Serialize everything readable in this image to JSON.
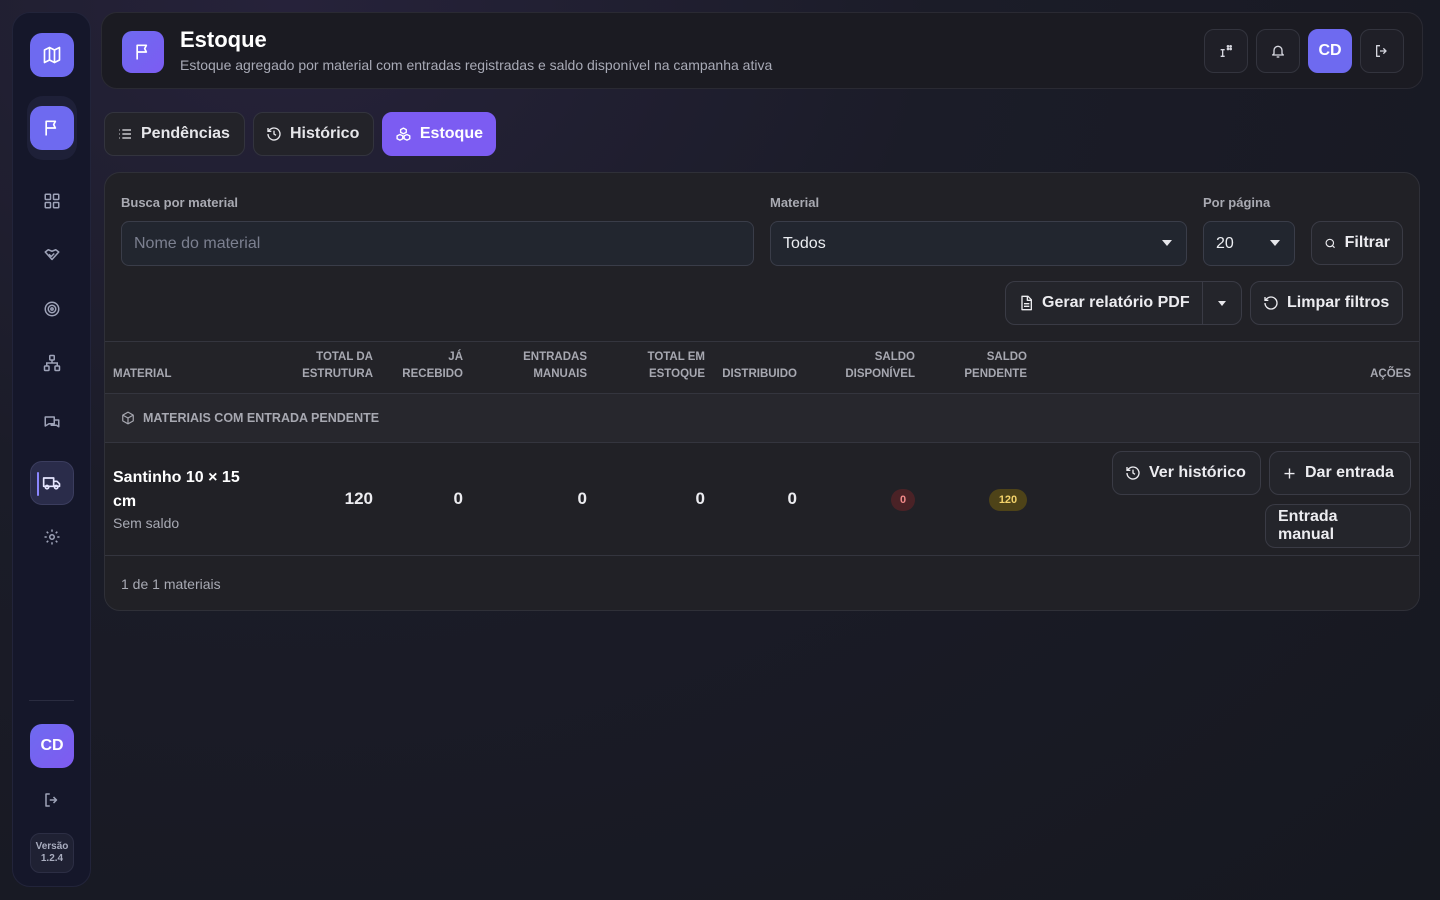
{
  "sidebar": {
    "avatar": "CD",
    "version_label": "Versão",
    "version": "1.2.4",
    "icons": [
      "map-icon",
      "flag-icon",
      "grid-icon",
      "handshake-icon",
      "target-icon",
      "org-chart-icon",
      "chat-icon",
      "truck-icon",
      "gear-icon",
      "logout-icon"
    ]
  },
  "header": {
    "title": "Estoque",
    "subtitle": "Estoque agregado por material com entradas registradas e saldo disponível na campanha ativa",
    "avatar": "CD"
  },
  "tabs": [
    {
      "label": "Pendências",
      "icon": "list-icon"
    },
    {
      "label": "Histórico",
      "icon": "history-icon"
    },
    {
      "label": "Estoque",
      "icon": "boxes-icon",
      "active": true
    }
  ],
  "filters": {
    "search_label": "Busca por material",
    "search_placeholder": "Nome do material",
    "search_value": "",
    "material_label": "Material",
    "material_value": "Todos",
    "per_page_label": "Por página",
    "per_page_value": "20",
    "filter_button": "Filtrar",
    "pdf_button": "Gerar relatório PDF",
    "clear_button": "Limpar filtros"
  },
  "table": {
    "headers": {
      "material": "MATERIAL",
      "total_estrutura": [
        "TOTAL DA",
        "ESTRUTURA"
      ],
      "ja_recebido": [
        "JÁ",
        "RECEBIDO"
      ],
      "entradas_manuais": [
        "ENTRADAS",
        "MANUAIS"
      ],
      "total_estoque": [
        "TOTAL EM",
        "ESTOQUE"
      ],
      "distribuido": "DISTRIBUIDO",
      "saldo_disponivel": [
        "SALDO",
        "DISPONÍVEL"
      ],
      "saldo_pendente": [
        "SALDO",
        "PENDENTE"
      ],
      "acoes": "AÇÕES"
    },
    "group_label": "MATERIAIS COM ENTRADA PENDENTE",
    "rows": [
      {
        "material": "Santinho 10 × 15 cm",
        "status": "Sem saldo",
        "total_estrutura": "120",
        "ja_recebido": "0",
        "entradas_manuais": "0",
        "total_estoque": "0",
        "distribuido": "0",
        "saldo_disponivel": "0",
        "saldo_pendente": "120",
        "actions": {
          "history": "Ver histórico",
          "entry": "Dar entrada",
          "manual": "Entrada manual"
        }
      }
    ],
    "footer": "1 de 1 materiais"
  },
  "colors": {
    "accent": "#6e6af0",
    "tab_active": "#7c5cf2",
    "danger": "#f28a8a",
    "warning": "#f3d36b"
  }
}
